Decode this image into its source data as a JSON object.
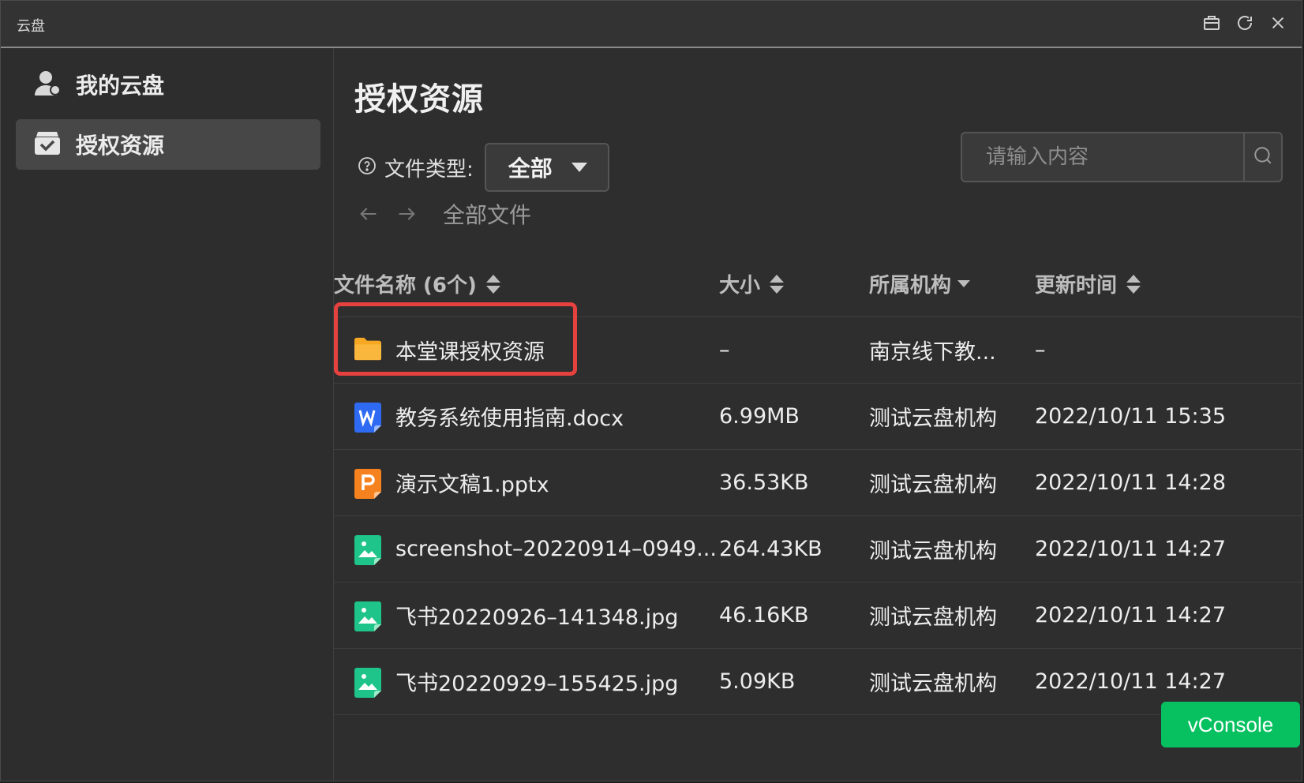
{
  "window": {
    "title": "云盘"
  },
  "sidebar": {
    "items": [
      {
        "label": "我的云盘",
        "icon": "user-icon",
        "active": false
      },
      {
        "label": "授权资源",
        "icon": "inbox-icon",
        "active": true
      }
    ]
  },
  "main": {
    "title": "授权资源",
    "filter": {
      "label": "文件类型:",
      "selected": "全部"
    },
    "search": {
      "placeholder": "请输入内容"
    },
    "breadcrumb": {
      "current": "全部文件"
    },
    "columns": {
      "name": "文件名称 (6个)",
      "size": "大小",
      "org": "所属机构",
      "time": "更新时间"
    },
    "rows": [
      {
        "type": "folder",
        "name": "本堂课授权资源",
        "size": "–",
        "org": "南京线下教...",
        "time": "–"
      },
      {
        "type": "docx",
        "name": "教务系统使用指南.docx",
        "size": "6.99MB",
        "org": "测试云盘机构",
        "time": "2022/10/11 15:35"
      },
      {
        "type": "pptx",
        "name": "演示文稿1.pptx",
        "size": "36.53KB",
        "org": "测试云盘机构",
        "time": "2022/10/11 14:28"
      },
      {
        "type": "image",
        "name": "screenshot–20220914–0949...",
        "size": "264.43KB",
        "org": "测试云盘机构",
        "time": "2022/10/11 14:27"
      },
      {
        "type": "image",
        "name": "飞书20220926–141348.jpg",
        "size": "46.16KB",
        "org": "测试云盘机构",
        "time": "2022/10/11 14:27"
      },
      {
        "type": "image",
        "name": "飞书20220929–155425.jpg",
        "size": "5.09KB",
        "org": "测试云盘机构",
        "time": "2022/10/11 14:27"
      }
    ]
  },
  "vconsole": {
    "label": "vConsole"
  },
  "colors": {
    "accent_green": "#07c160",
    "highlight_red": "#e5413f",
    "folder_yellow": "#f7a823",
    "docx_blue": "#2f6bf2",
    "pptx_orange": "#f5821f",
    "image_green": "#1ec48a"
  }
}
